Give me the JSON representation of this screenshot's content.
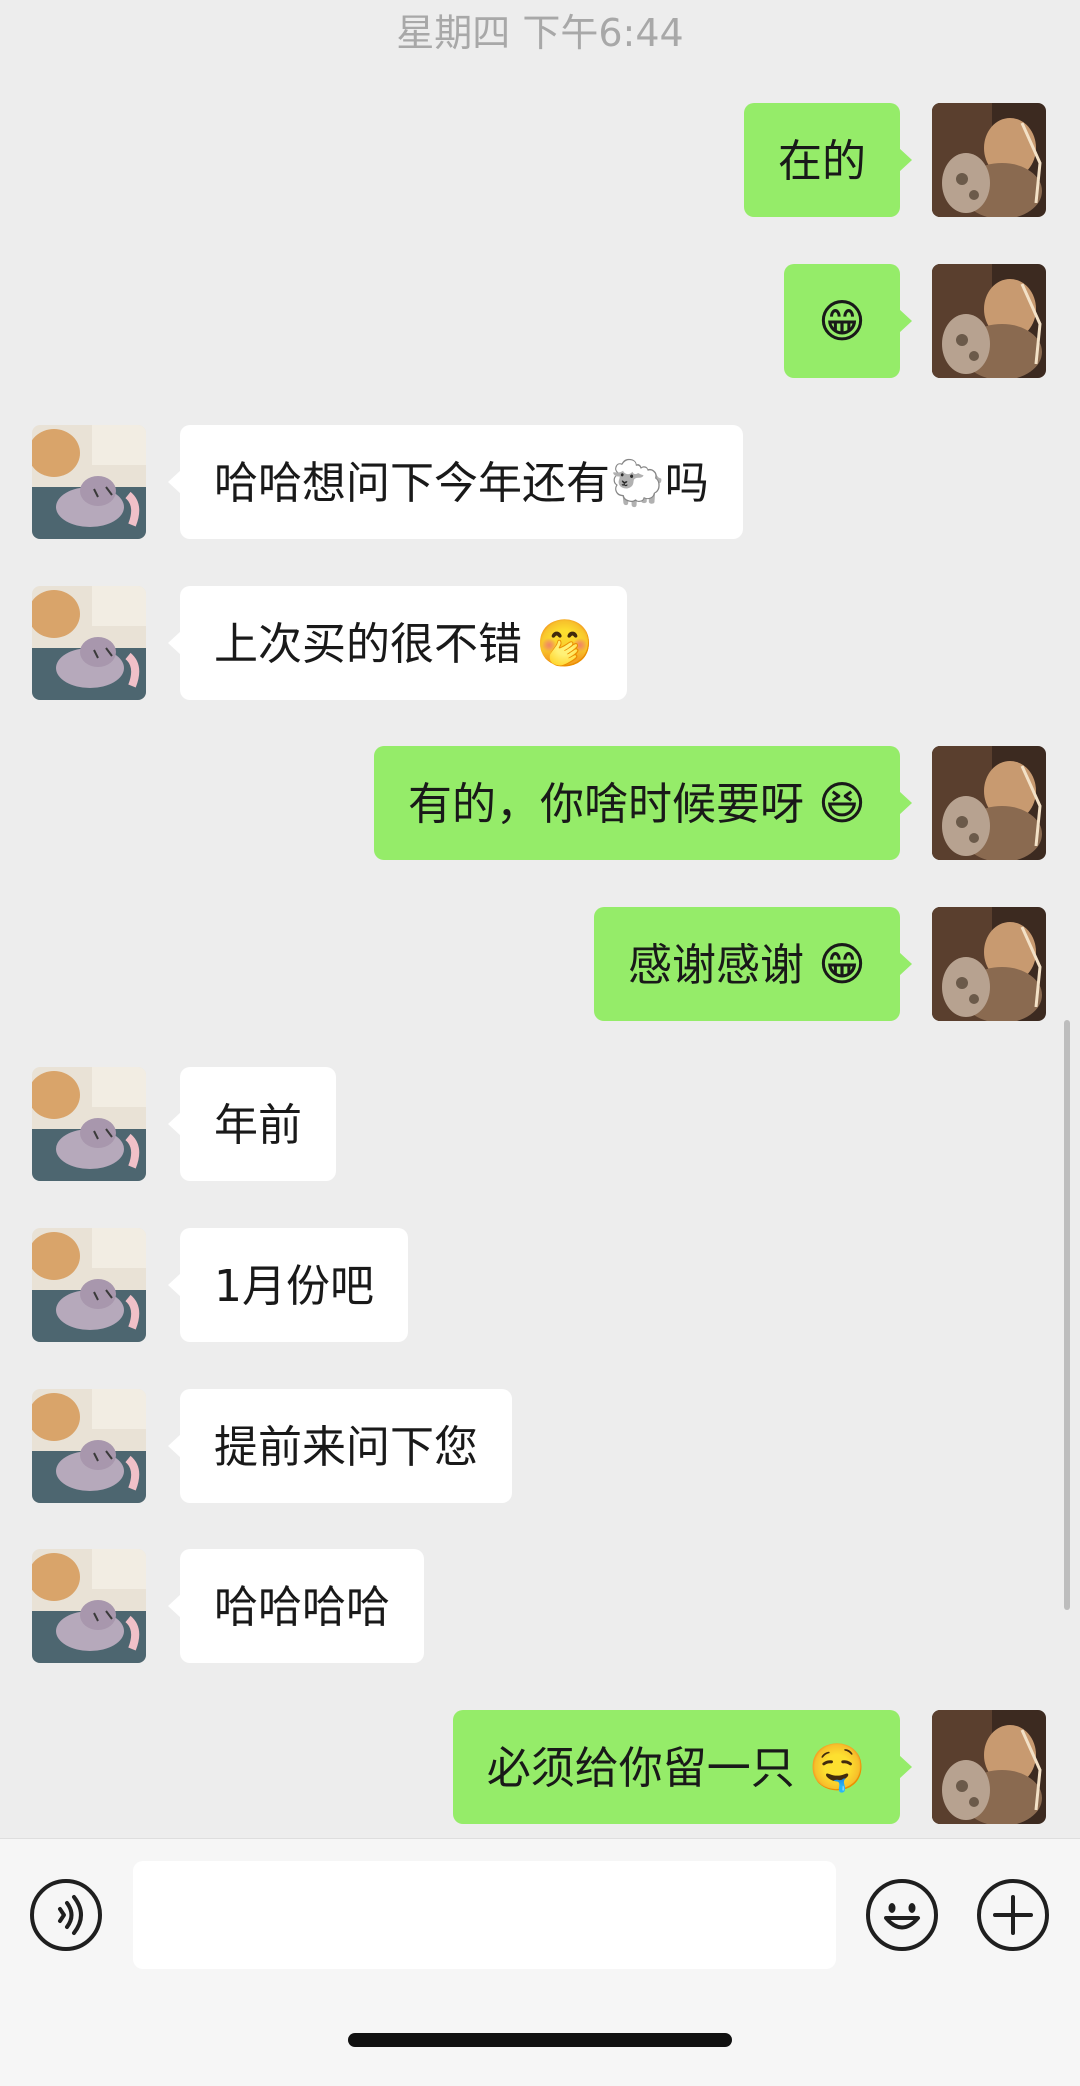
{
  "timestamp": "星期四 下午6:44",
  "messages": [
    {
      "side": "out",
      "text": "在的",
      "emoji": ""
    },
    {
      "side": "out",
      "text": "",
      "emoji": "😁"
    },
    {
      "side": "in",
      "text": "哈哈想问下今年还有🐑吗",
      "emoji": ""
    },
    {
      "side": "in",
      "text": "上次买的很不错",
      "emoji": "🤭"
    },
    {
      "side": "out",
      "text": "有的，你啥时候要呀",
      "emoji": "😆"
    },
    {
      "side": "out",
      "text": "感谢感谢",
      "emoji": "😁"
    },
    {
      "side": "in",
      "text": "年前",
      "emoji": ""
    },
    {
      "side": "in",
      "text": "1月份吧",
      "emoji": ""
    },
    {
      "side": "in",
      "text": "提前来问下您",
      "emoji": ""
    },
    {
      "side": "in",
      "text": "哈哈哈哈",
      "emoji": ""
    },
    {
      "side": "out",
      "text": "必须给你留一只",
      "emoji": "🤤"
    }
  ],
  "input": {
    "value": "",
    "placeholder": "",
    "voice_icon": "voice-icon",
    "emoji_icon": "smile-icon",
    "plus_icon": "plus-icon"
  },
  "colors": {
    "background": "#ededed",
    "outgoing_bubble": "#95ec69",
    "incoming_bubble": "#ffffff"
  }
}
